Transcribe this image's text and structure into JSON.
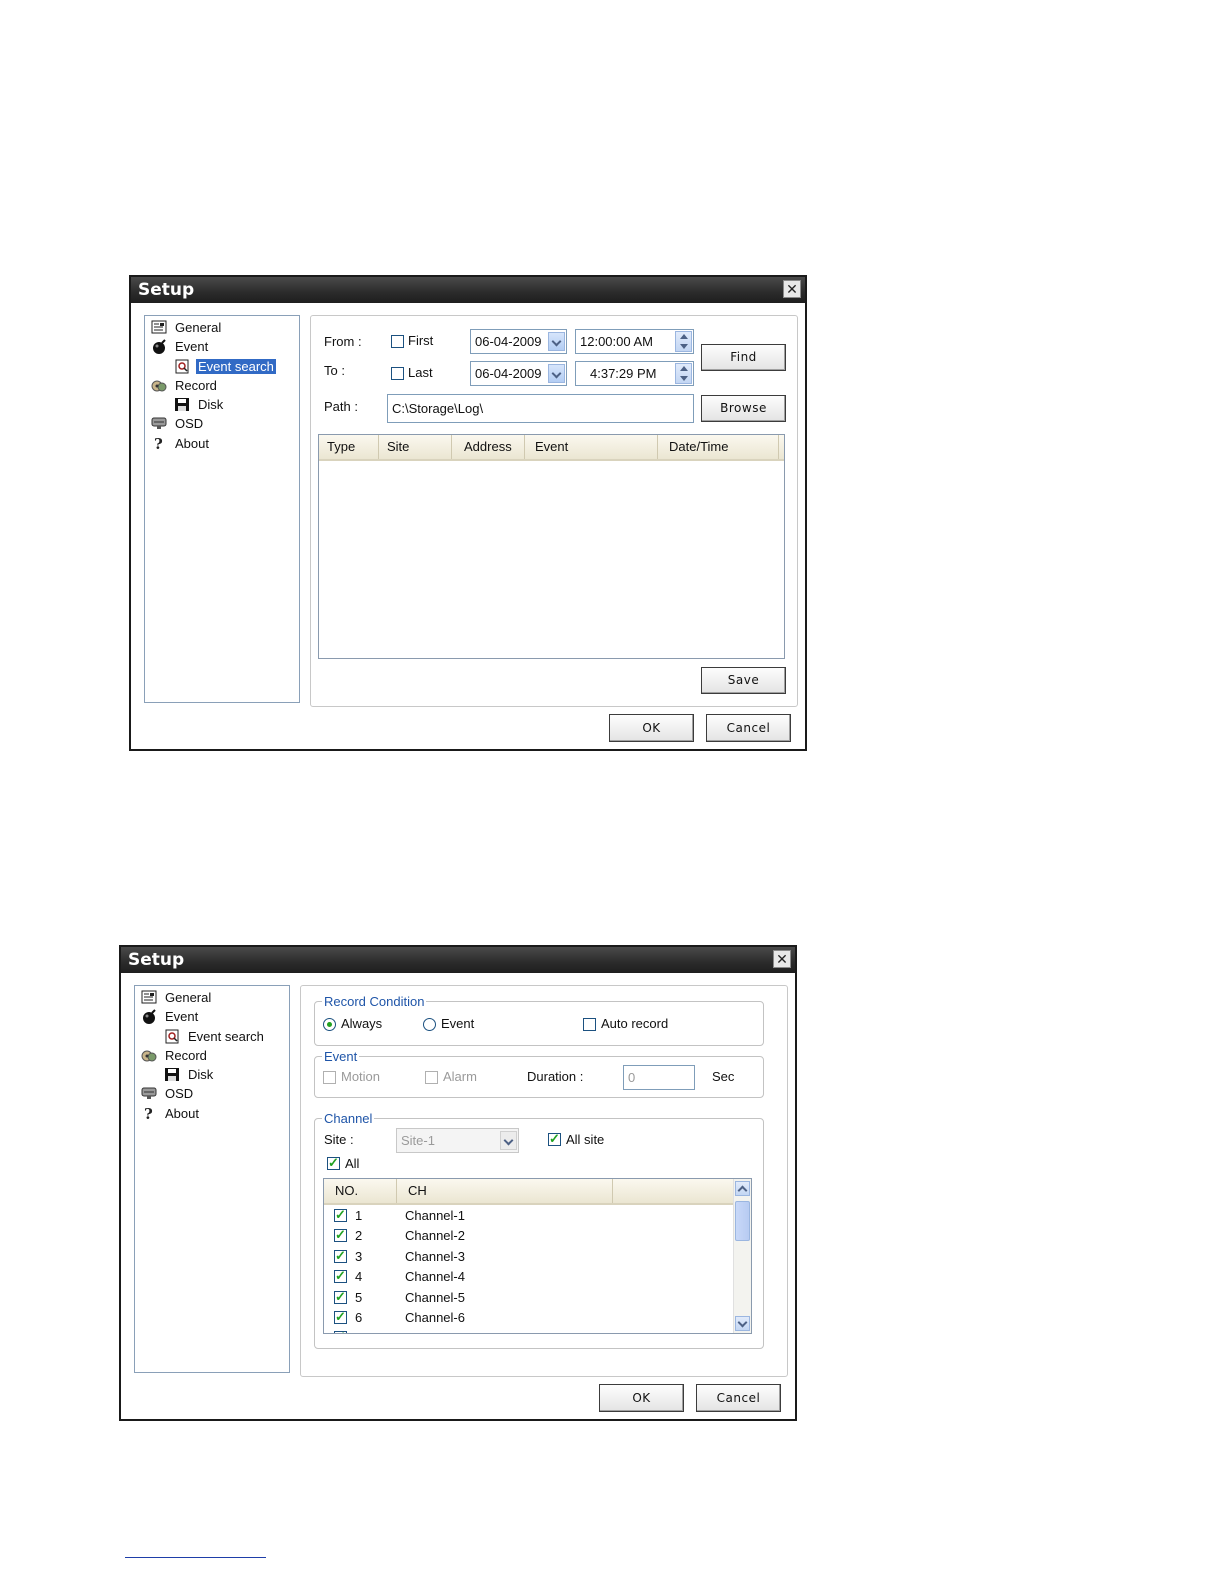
{
  "dialog1": {
    "title": "Setup",
    "tree": [
      {
        "label": "General",
        "icon": "general-icon"
      },
      {
        "label": "Event",
        "icon": "event-bomb-icon"
      },
      {
        "label": "Event search",
        "icon": "event-search-icon",
        "selected": true
      },
      {
        "label": "Record",
        "icon": "record-icon"
      },
      {
        "label": "Disk",
        "icon": "floppy-disk-icon"
      },
      {
        "label": "OSD",
        "icon": "osd-monitor-icon"
      },
      {
        "label": "About",
        "icon": "about-question-icon"
      }
    ],
    "from_label": "From :",
    "to_label": "To :",
    "first_label": "First",
    "last_label": "Last",
    "from_date": "06-04-2009",
    "from_time": "12:00:00 AM",
    "to_date": "06-04-2009",
    "to_time": "4:37:29 PM",
    "find_label": "Find",
    "path_label": "Path :",
    "path_value": "C:\\Storage\\Log\\",
    "browse_label": "Browse",
    "columns": [
      "Type",
      "Site",
      "Address",
      "Event",
      "Date/Time"
    ],
    "save_label": "Save",
    "ok_label": "OK",
    "cancel_label": "Cancel"
  },
  "dialog2": {
    "title": "Setup",
    "tree": [
      {
        "label": "General",
        "icon": "general-icon"
      },
      {
        "label": "Event",
        "icon": "event-bomb-icon"
      },
      {
        "label": "Event search",
        "icon": "event-search-icon"
      },
      {
        "label": "Record",
        "icon": "record-icon"
      },
      {
        "label": "Disk",
        "icon": "floppy-disk-icon"
      },
      {
        "label": "OSD",
        "icon": "osd-monitor-icon"
      },
      {
        "label": "About",
        "icon": "about-question-icon"
      }
    ],
    "record_condition": {
      "legend": "Record Condition",
      "always_label": "Always",
      "event_label": "Event",
      "auto_record_label": "Auto record",
      "selected": "Always"
    },
    "event_group": {
      "legend": "Event",
      "motion_label": "Motion",
      "alarm_label": "Alarm",
      "duration_label": "Duration :",
      "duration_value": "0",
      "sec_label": "Sec"
    },
    "channel_group": {
      "legend": "Channel",
      "site_label": "Site :",
      "site_value": "Site-1",
      "all_site_label": "All site",
      "all_label": "All",
      "columns": [
        "NO.",
        "CH"
      ],
      "rows": [
        {
          "no": "1",
          "ch": "Channel-1"
        },
        {
          "no": "2",
          "ch": "Channel-2"
        },
        {
          "no": "3",
          "ch": "Channel-3"
        },
        {
          "no": "4",
          "ch": "Channel-4"
        },
        {
          "no": "5",
          "ch": "Channel-5"
        },
        {
          "no": "6",
          "ch": "Channel-6"
        }
      ]
    },
    "ok_label": "OK",
    "cancel_label": "Cancel"
  }
}
